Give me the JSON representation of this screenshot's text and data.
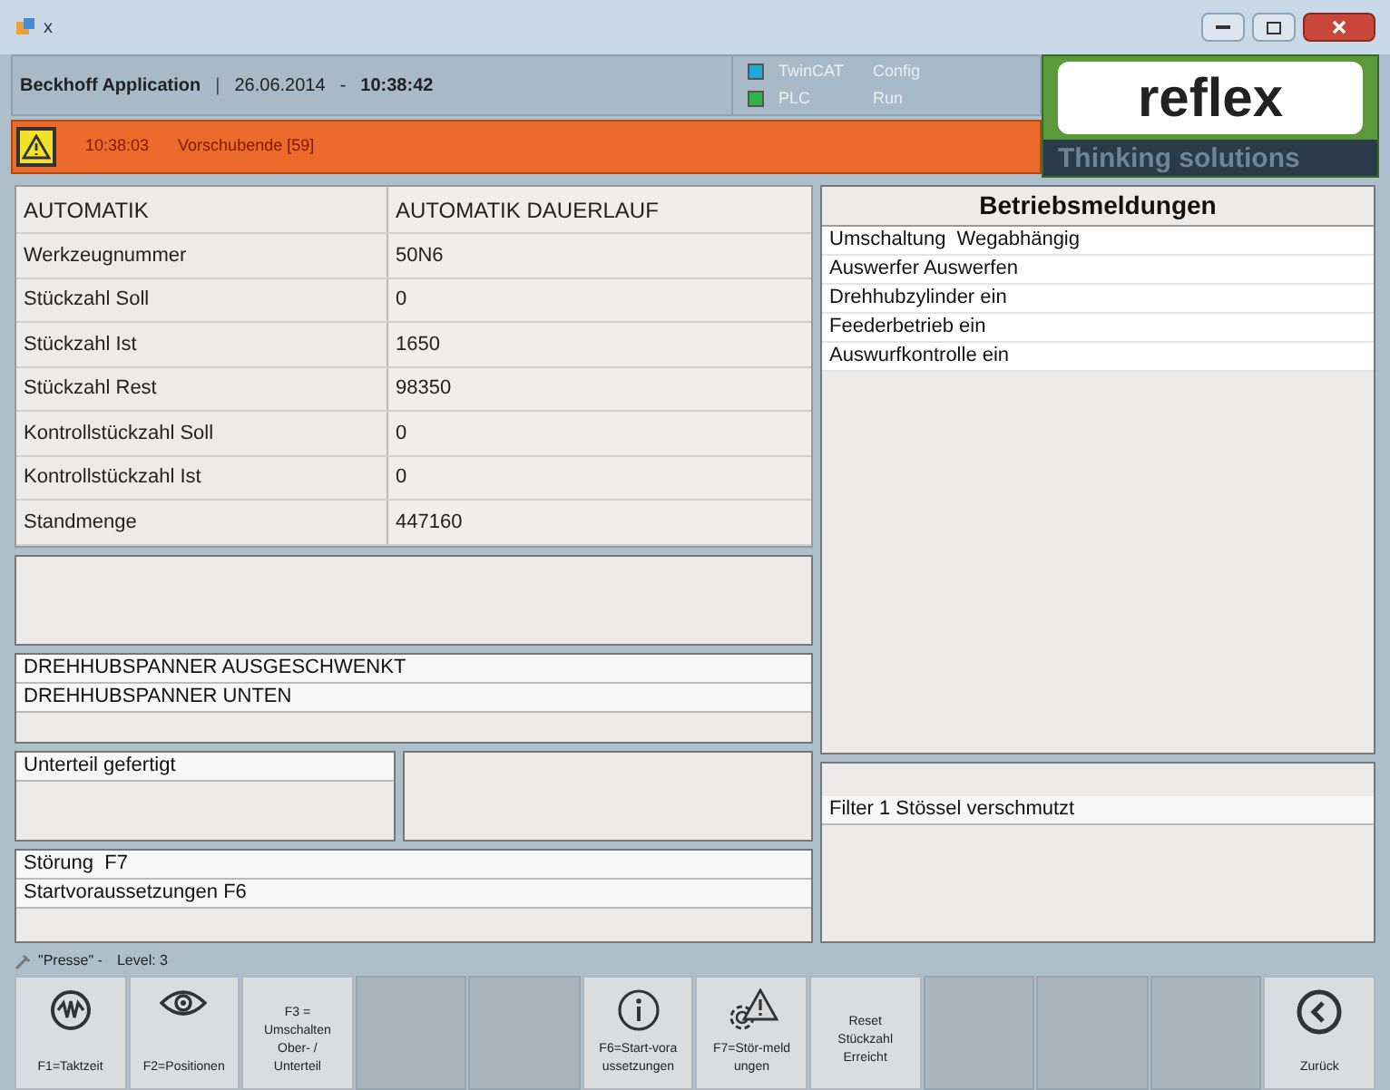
{
  "window": {
    "title": "x"
  },
  "header": {
    "app": "Beckhoff Application",
    "divider": "|",
    "date": "26.06.2014",
    "separator": "-",
    "time": "10:38:42",
    "indicators": [
      {
        "name": "TwinCAT",
        "state": "Config",
        "color": "#1fa8d8"
      },
      {
        "name": "PLC",
        "state": "Run",
        "color": "#2fb34a"
      }
    ],
    "logo": {
      "name": "reflex",
      "tagline": "Thinking solutions"
    }
  },
  "alarm": {
    "time": "10:38:03",
    "message": "Vorschubende [59]"
  },
  "parameters": [
    {
      "label": "AUTOMATIK",
      "value": "AUTOMATIK DAUERLAUF"
    },
    {
      "label": "Werkzeugnummer",
      "value": "50N6"
    },
    {
      "label": "Stückzahl Soll",
      "value": "0"
    },
    {
      "label": "Stückzahl Ist",
      "value": "1650"
    },
    {
      "label": "Stückzahl Rest",
      "value": "98350"
    },
    {
      "label": "Kontrollstückzahl Soll",
      "value": "0"
    },
    {
      "label": "Kontrollstückzahl Ist",
      "value": "0"
    },
    {
      "label": "Standmenge",
      "value": "447160"
    }
  ],
  "clamp_messages": [
    "DREHHUBSPANNER AUSGESCHWENKT",
    "DREHHUBSPANNER UNTEN"
  ],
  "part_status": [
    "Unterteil gefertigt"
  ],
  "fault_messages": [
    "Störung  F7",
    "Startvoraussetzungen F6"
  ],
  "operating_messages": {
    "title": "Betriebsmeldungen",
    "items": [
      "Umschaltung  Wegabhängig",
      "Auswerfer Auswerfen",
      "Drehhubzylinder ein",
      "Feederbetrieb ein",
      "Auswurfkontrolle ein"
    ]
  },
  "maintenance_messages": [
    "Filter 1 Stössel verschmutzt"
  ],
  "status_bar": {
    "machine": "\"Presse\" -",
    "level": "Level: 3"
  },
  "function_keys": [
    {
      "kind": "wave",
      "label": "F1=Taktzeit"
    },
    {
      "kind": "eye",
      "label": "F2=Positionen"
    },
    {
      "kind": "text",
      "label": "F3 =\nUmschalten\nOber- /\nUnterteil"
    },
    {
      "kind": "empty"
    },
    {
      "kind": "empty"
    },
    {
      "kind": "info",
      "label": "F6=Start-vora\nussetzungen"
    },
    {
      "kind": "alert",
      "label": "F7=Stör-meld\nungen"
    },
    {
      "kind": "text",
      "label": "Reset\nStückzahl\nErreicht"
    },
    {
      "kind": "empty"
    },
    {
      "kind": "empty"
    },
    {
      "kind": "empty"
    },
    {
      "kind": "back",
      "label": "Zurück"
    }
  ]
}
